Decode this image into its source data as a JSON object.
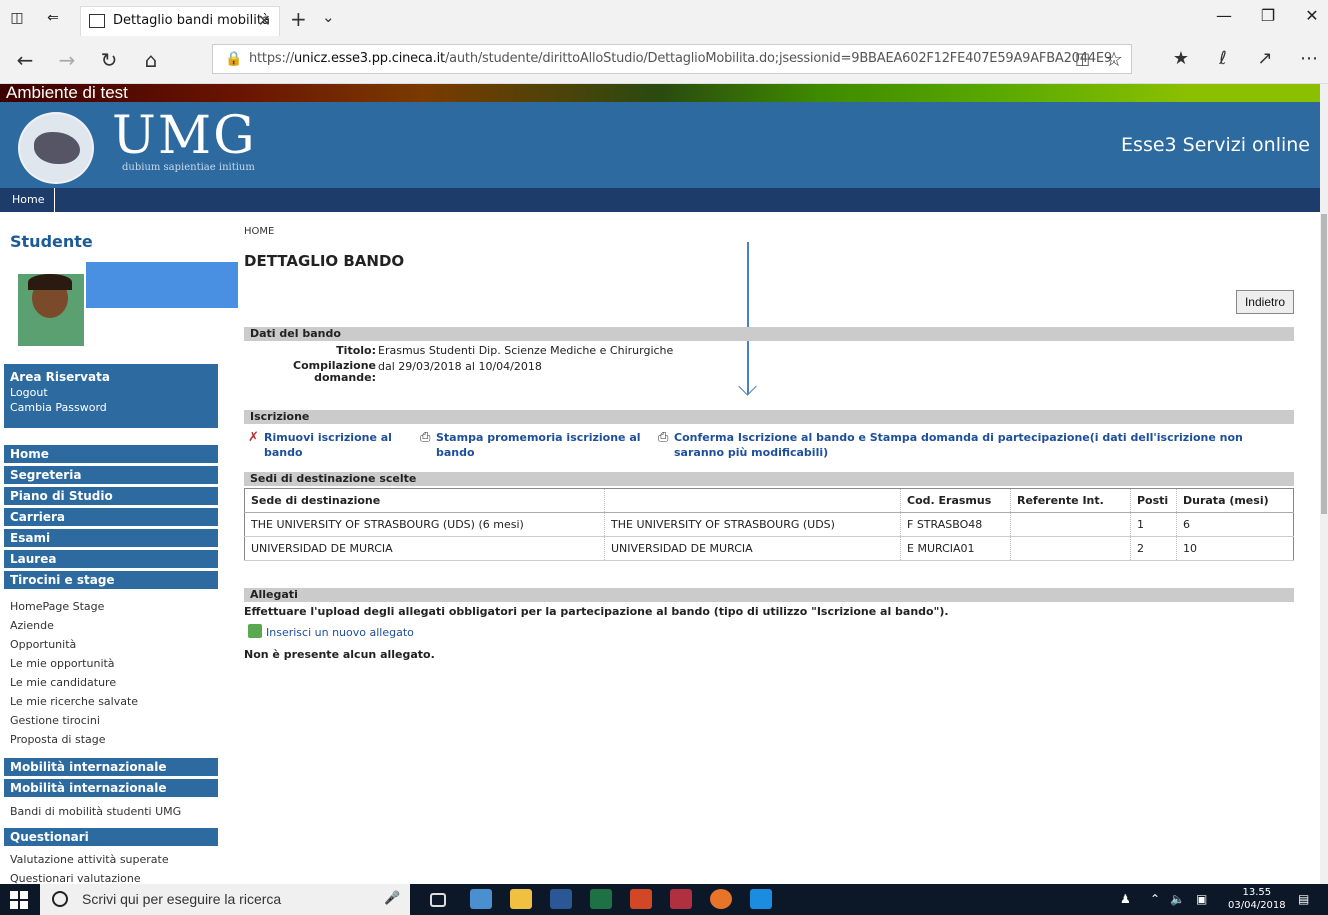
{
  "browser": {
    "tab_title": "Dettaglio bandi mobilità",
    "url_prefix": "https://",
    "url_domain": "unicz.esse3.pp.cineca.it",
    "url_path": "/auth/studente/dirittoAlloStudio/DettaglioMobilita.do;jsessionid=9BBAEA602F12FE407E59A9AFBA2044E9."
  },
  "header": {
    "test_banner": "Ambiente di test",
    "logo_text": "UMG",
    "motto": "dubium sapientiae initium",
    "service_title": "Esse3 Servizi online",
    "nav_home": "Home"
  },
  "sidebar": {
    "title": "Studente",
    "area": {
      "title": "Area Riservata",
      "logout": "Logout",
      "change_password": "Cambia Password"
    },
    "menu": [
      "Home",
      "Segreteria",
      "Piano di Studio",
      "Carriera",
      "Esami",
      "Laurea",
      "Tirocini e stage"
    ],
    "stage_items": [
      "HomePage Stage",
      "Aziende",
      "Opportunità",
      "Le mie opportunità",
      "Le mie candidature",
      "Le mie ricerche salvate",
      "Gestione tirocini",
      "Proposta di stage"
    ],
    "mobility_1": "Mobilità internazionale",
    "mobility_2": "Mobilità internazionale",
    "mobility_item": "Bandi di mobilità studenti UMG",
    "surveys": "Questionari",
    "survey_items": [
      "Valutazione attività superate",
      "Questionari valutazione"
    ]
  },
  "main": {
    "breadcrumb": "HOME",
    "title": "DETTAGLIO BANDO",
    "back_button": "Indietro",
    "section_data": "Dati del bando",
    "titolo_label": "Titolo:",
    "titolo_value": "Erasmus Studenti Dip. Scienze Mediche e Chirurgiche",
    "compilazione_label": "Compilazione domande:",
    "compilazione_value": "dal 29/03/2018 al 10/04/2018",
    "section_iscrizione": "Iscrizione",
    "action_remove": "Rimuovi iscrizione al bando",
    "action_print": "Stampa promemoria iscrizione al bando",
    "action_confirm": "Conferma Iscrizione al bando e Stampa domanda di partecipazione(i dati dell'iscrizione non saranno più modificabili)",
    "section_sedi": "Sedi di destinazione scelte",
    "table_headers": [
      "Sede di destinazione",
      "",
      "Cod. Erasmus",
      "Referente Int.",
      "Posti",
      "Durata (mesi)"
    ],
    "table_rows": [
      [
        "THE UNIVERSITY OF STRASBOURG (UDS) (6 mesi)",
        "THE UNIVERSITY OF STRASBOURG (UDS)",
        "F STRASBO48",
        "",
        "1",
        "6"
      ],
      [
        "UNIVERSIDAD DE MURCIA",
        "UNIVERSIDAD DE MURCIA",
        "E MURCIA01",
        "",
        "2",
        "10"
      ]
    ],
    "section_allegati": "Allegati",
    "allegati_note": "Effettuare l'upload degli allegati obbligatori per la partecipazione al bando (tipo di utilizzo \"Iscrizione al bando\").",
    "add_attachment": "Inserisci un nuovo allegato",
    "no_attachment": "Non è presente alcun allegato."
  },
  "taskbar": {
    "search_placeholder": "Scrivi qui per eseguire la ricerca",
    "time": "13.55",
    "date": "03/04/2018"
  }
}
